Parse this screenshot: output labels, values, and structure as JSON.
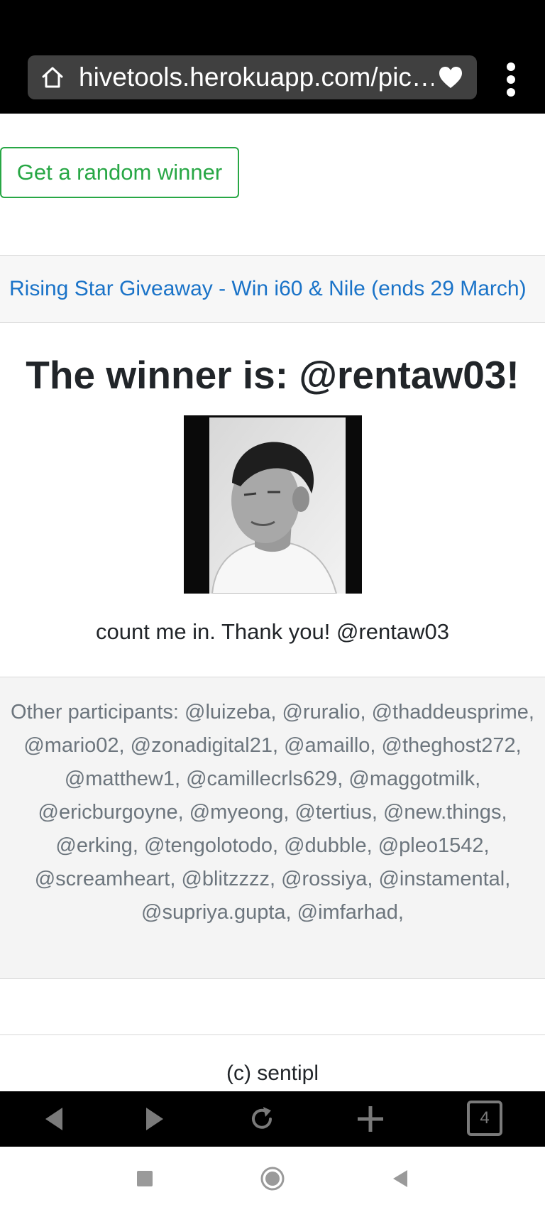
{
  "browser": {
    "url": "hivetools.herokuapp.com/pic…",
    "tab_count": "4"
  },
  "page": {
    "random_winner_button": "Get a random winner",
    "giveaway_link": "Rising Star Giveaway - Win i60 & Nile (ends 29 March)",
    "winner_title": "The winner is: @rentaw03!",
    "winner_comment": "count me in. Thank you! @rentaw03",
    "other_participants": "Other participants: @luizeba, @ruralio, @thaddeusprime, @mario02, @zonadigital21, @amaillo, @theghost272, @matthew1, @camillecrls629, @maggotmilk, @ericburgoyne, @myeong, @tertius, @new.things, @erking, @tengolotodo, @dubble, @pleo1542, @screamheart, @blitzzzz, @rossiya, @instamental, @supriya.gupta, @imfarhad,",
    "footer": "(c) sentipl"
  },
  "colors": {
    "success_green": "#28a745",
    "link_blue": "#1a73c8",
    "muted_gray": "#6c757d"
  },
  "icons": {
    "url_bar": [
      "home-icon",
      "heart-icon"
    ],
    "toolbar": [
      "back-arrow-icon",
      "forward-arrow-icon",
      "reload-icon",
      "plus-icon",
      "tabs-icon",
      "menu-dots-icon"
    ],
    "system_nav": [
      "recents-square-icon",
      "home-circle-icon",
      "back-triangle-icon"
    ]
  }
}
